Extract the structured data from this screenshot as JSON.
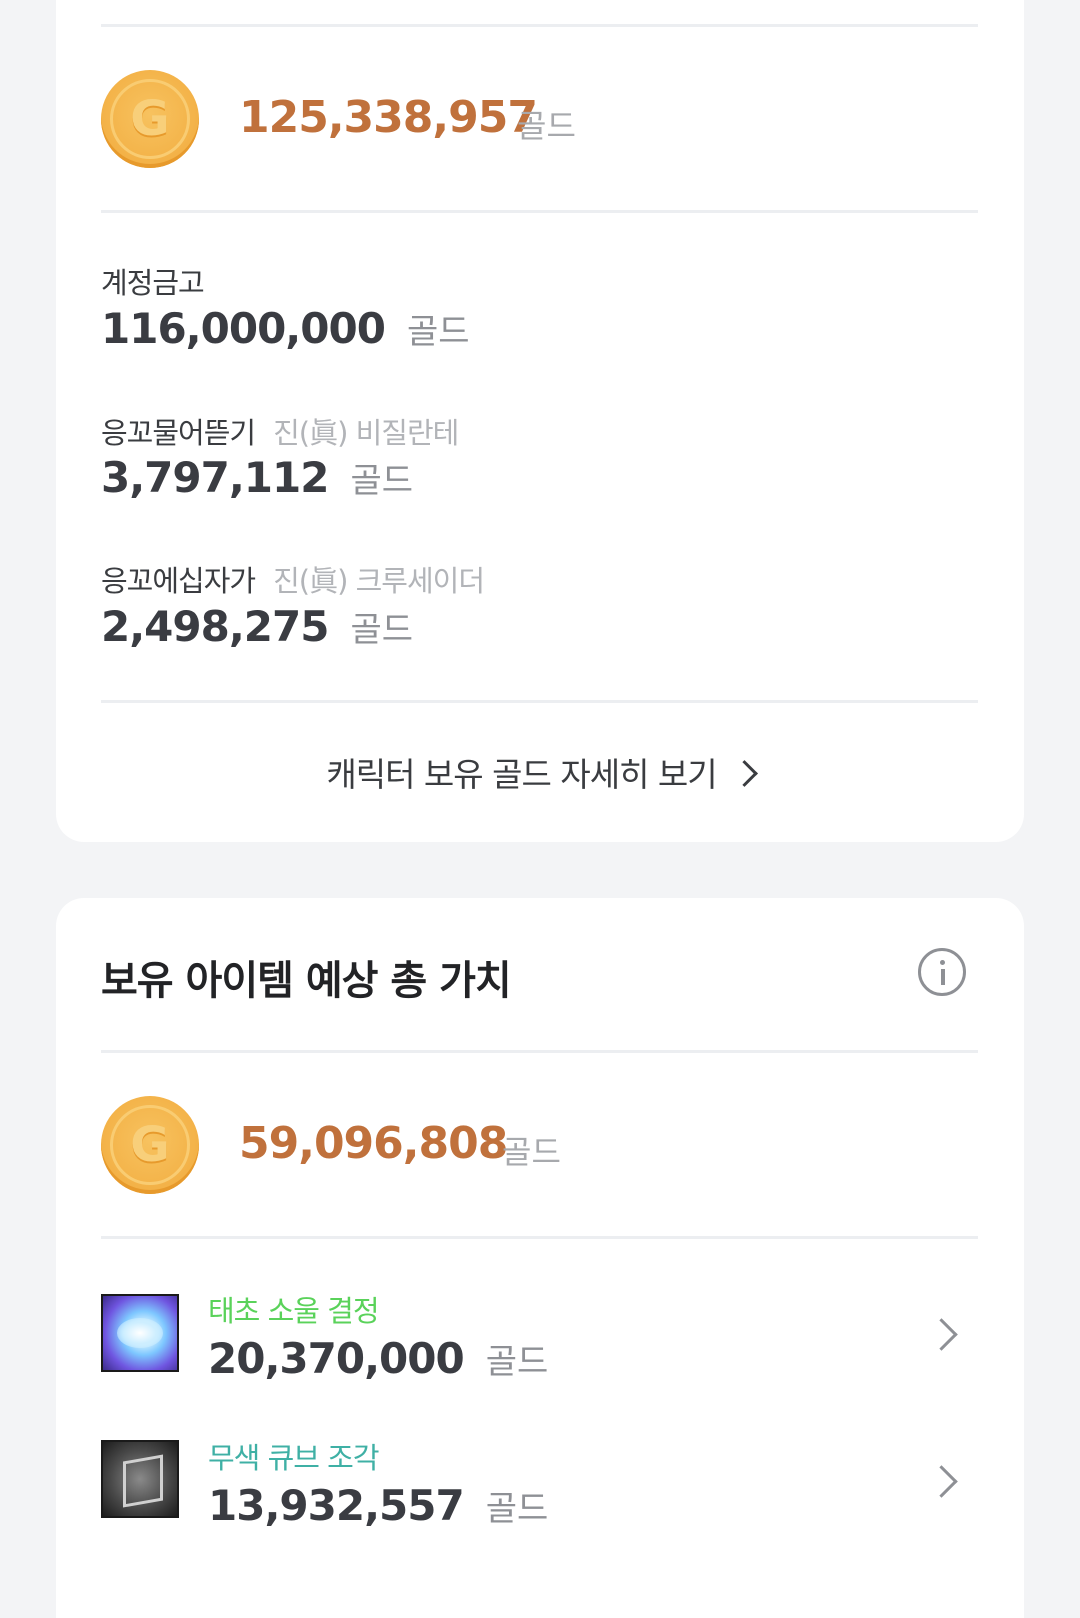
{
  "gold_summary": {
    "total": "125,338,957",
    "unit": "골드",
    "coin_letter": "G"
  },
  "accounts": [
    {
      "label": "계정금고",
      "sub": "",
      "amount": "116,000,000",
      "unit": "골드"
    },
    {
      "label": "응꼬물어뜯기",
      "sub": "진(眞) 비질란테",
      "amount": "3,797,112",
      "unit": "골드"
    },
    {
      "label": "응꼬에십자가",
      "sub": "진(眞) 크루세이더",
      "amount": "2,498,275",
      "unit": "골드"
    }
  ],
  "detail_link": {
    "label": "캐릭터 보유 골드 자세히 보기"
  },
  "item_value": {
    "title": "보유 아이템 예상 총 가치",
    "total": "59,096,808",
    "unit": "골드",
    "coin_letter": "G",
    "items": [
      {
        "name": "태초 소울 결정",
        "name_color": "#5ad25a",
        "amount": "20,370,000",
        "unit": "골드",
        "icon": "soul-crystal-icon"
      },
      {
        "name": "무색 큐브 조각",
        "name_color": "#3fb0a5",
        "amount": "13,932,557",
        "unit": "골드",
        "icon": "colorless-cube-icon"
      }
    ]
  }
}
